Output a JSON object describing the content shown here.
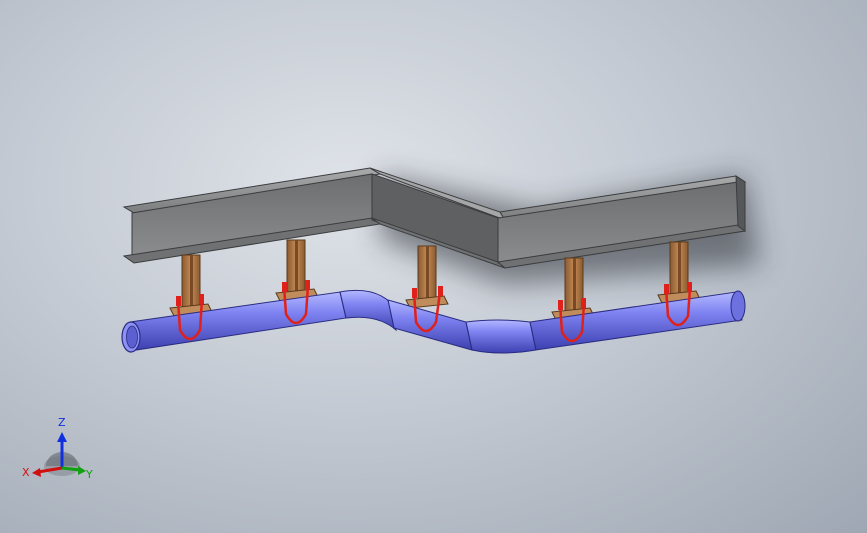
{
  "viewport": {
    "background_top": "#dfe3e9",
    "background_bottom": "#9ea7b3"
  },
  "model": {
    "beam_color": "#7d7f81",
    "pipe_color": "#7a7ef0",
    "support_color": "#b07a4a",
    "clamp_color": "#e0201a"
  },
  "triad": {
    "x_label": "X",
    "y_label": "Y",
    "z_label": "Z",
    "x_color": "#d01010",
    "y_color": "#10a010",
    "z_color": "#1030e0"
  }
}
